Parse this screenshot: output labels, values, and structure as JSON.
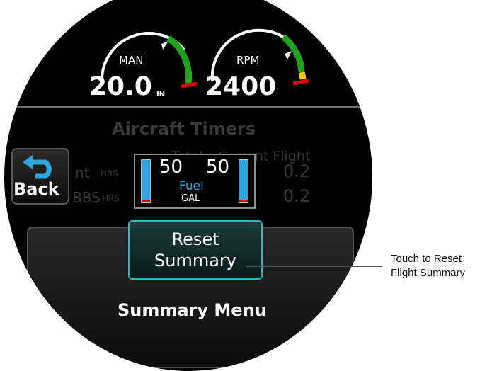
{
  "gauges": {
    "man": {
      "label": "MAN",
      "value": "20.0",
      "unit": "IN"
    },
    "rpm": {
      "label": "RPM",
      "value": "2400"
    }
  },
  "timers": {
    "title": "Aircraft Timers",
    "col_total": "Total",
    "col_current": "Current Flight",
    "row1_label": "nt",
    "row1_unit": "HRS",
    "row1_value": "0.2",
    "row2_label": "BBS",
    "row2_unit": "HRS",
    "row2_value": "0.2"
  },
  "back_button": {
    "label": "Back",
    "icon": "back-arrow-icon"
  },
  "fuel": {
    "left_value": "50",
    "right_value": "50",
    "label": "Fuel",
    "unit": "GAL"
  },
  "summary_menu": {
    "reset_line1": "Reset",
    "reset_line2": "Summary",
    "title": "Summary Menu"
  },
  "callout": {
    "line1": "Touch to Reset",
    "line2": "Flight Summary"
  },
  "colors": {
    "accent": "#2fb5c3",
    "fuel_bar": "#2ea7e0",
    "gauge_green": "#21a11f",
    "gauge_red": "#e00000",
    "gauge_yellow": "#f0d000"
  }
}
